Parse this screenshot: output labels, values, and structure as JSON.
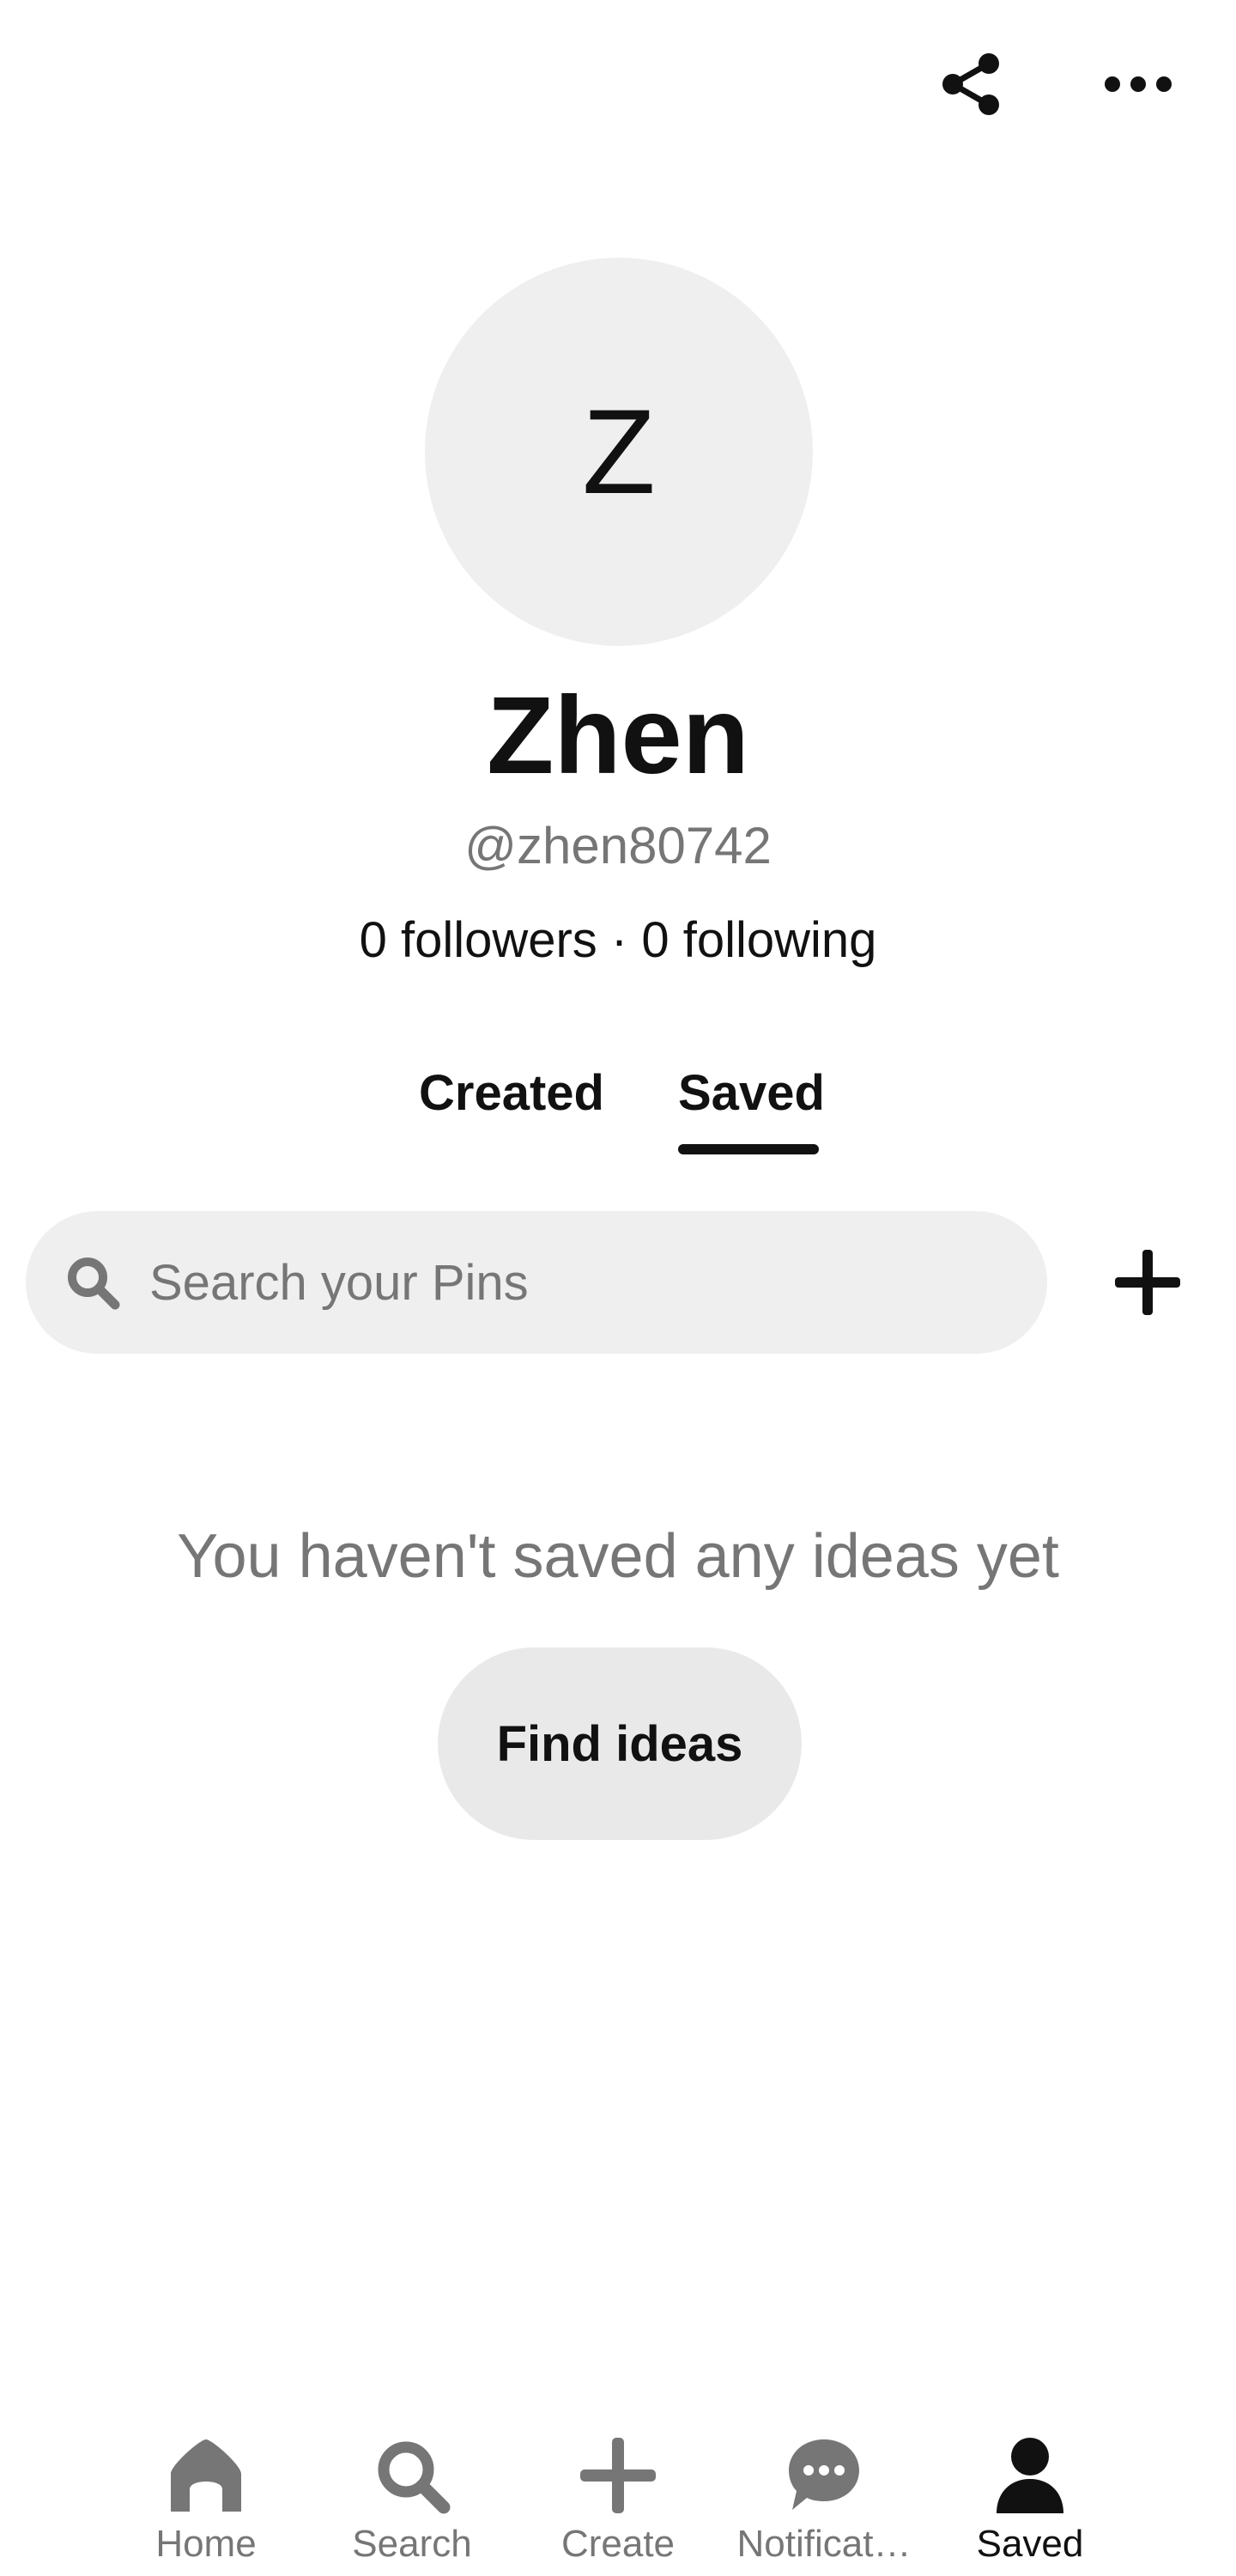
{
  "profile": {
    "avatar_letter": "Z",
    "name": "Zhen",
    "handle": "@zhen80742",
    "follow_stats": "0 followers · 0 following"
  },
  "tabs": [
    {
      "label": "Created",
      "active": false
    },
    {
      "label": "Saved",
      "active": true
    }
  ],
  "search": {
    "placeholder": "Search your Pins"
  },
  "empty_state": {
    "message": "You haven't saved any ideas yet",
    "button_label": "Find ideas"
  },
  "bottom_nav": [
    {
      "label": "Home",
      "icon": "home-icon",
      "active": false
    },
    {
      "label": "Search",
      "icon": "search-icon",
      "active": false
    },
    {
      "label": "Create",
      "icon": "plus-icon",
      "active": false
    },
    {
      "label": "Notificat…",
      "icon": "chat-bubble-icon",
      "active": false
    },
    {
      "label": "Saved",
      "icon": "person-icon",
      "active": true
    }
  ],
  "colors": {
    "text_primary": "#111111",
    "text_secondary": "#767676",
    "surface_gray": "#efefef",
    "button_gray": "#e9e9e9",
    "inactive_icon": "#767676"
  }
}
